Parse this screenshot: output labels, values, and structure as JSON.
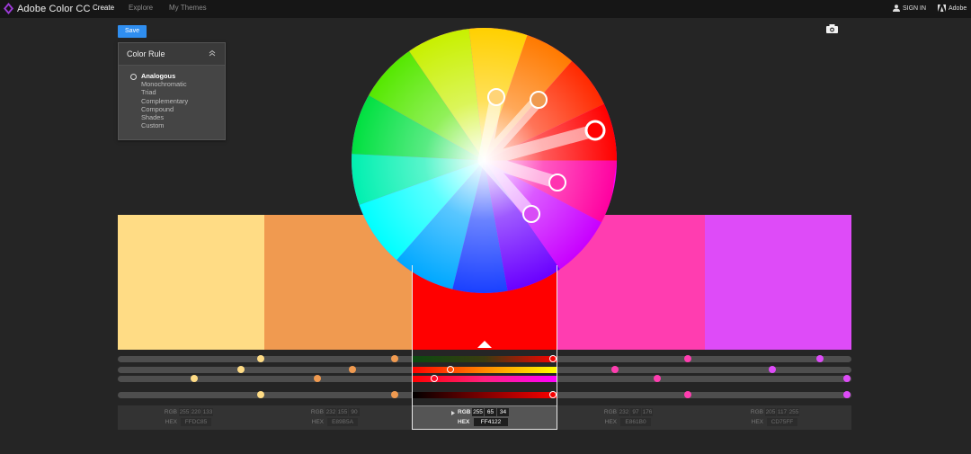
{
  "app": {
    "title": "Adobe Color CC"
  },
  "nav": {
    "create": "Create",
    "explore": "Explore",
    "my_themes": "My Themes"
  },
  "header": {
    "sign_in": "SIGN IN",
    "adobe": "Adobe"
  },
  "toolbar": {
    "save": "Save",
    "camera_icon": "camera-icon"
  },
  "color_rule": {
    "title": "Color Rule",
    "selected": "Analogous",
    "options": [
      "Analogous",
      "Monochromatic",
      "Triad",
      "Complementary",
      "Compound",
      "Shades",
      "Custom"
    ]
  },
  "swatches": [
    {
      "hex": "#FFDC85",
      "rgb": [
        "255",
        "220",
        "133"
      ],
      "hex_label": "FFDC85"
    },
    {
      "hex": "#E89B5A",
      "rgb": [
        "232",
        "155",
        "90"
      ],
      "hex_label": "E89B5A"
    },
    {
      "hex": "#FF0000",
      "rgb": [
        "255",
        "65",
        "34"
      ],
      "hex_label": "FF4122"
    },
    {
      "hex": "#FF3DB0",
      "rgb": [
        "232",
        "97",
        "176"
      ],
      "hex_label": "E861B0"
    },
    {
      "hex": "#DE4BF8",
      "rgb": [
        "205",
        "117",
        "255"
      ],
      "hex_label": "CD75FF"
    }
  ],
  "selected_index": 2,
  "labels": {
    "rgb": "RGB",
    "hex": "HEX"
  },
  "colors": {
    "accent": "#2f8ef0",
    "background": "#252525",
    "topbar": "#161616"
  }
}
